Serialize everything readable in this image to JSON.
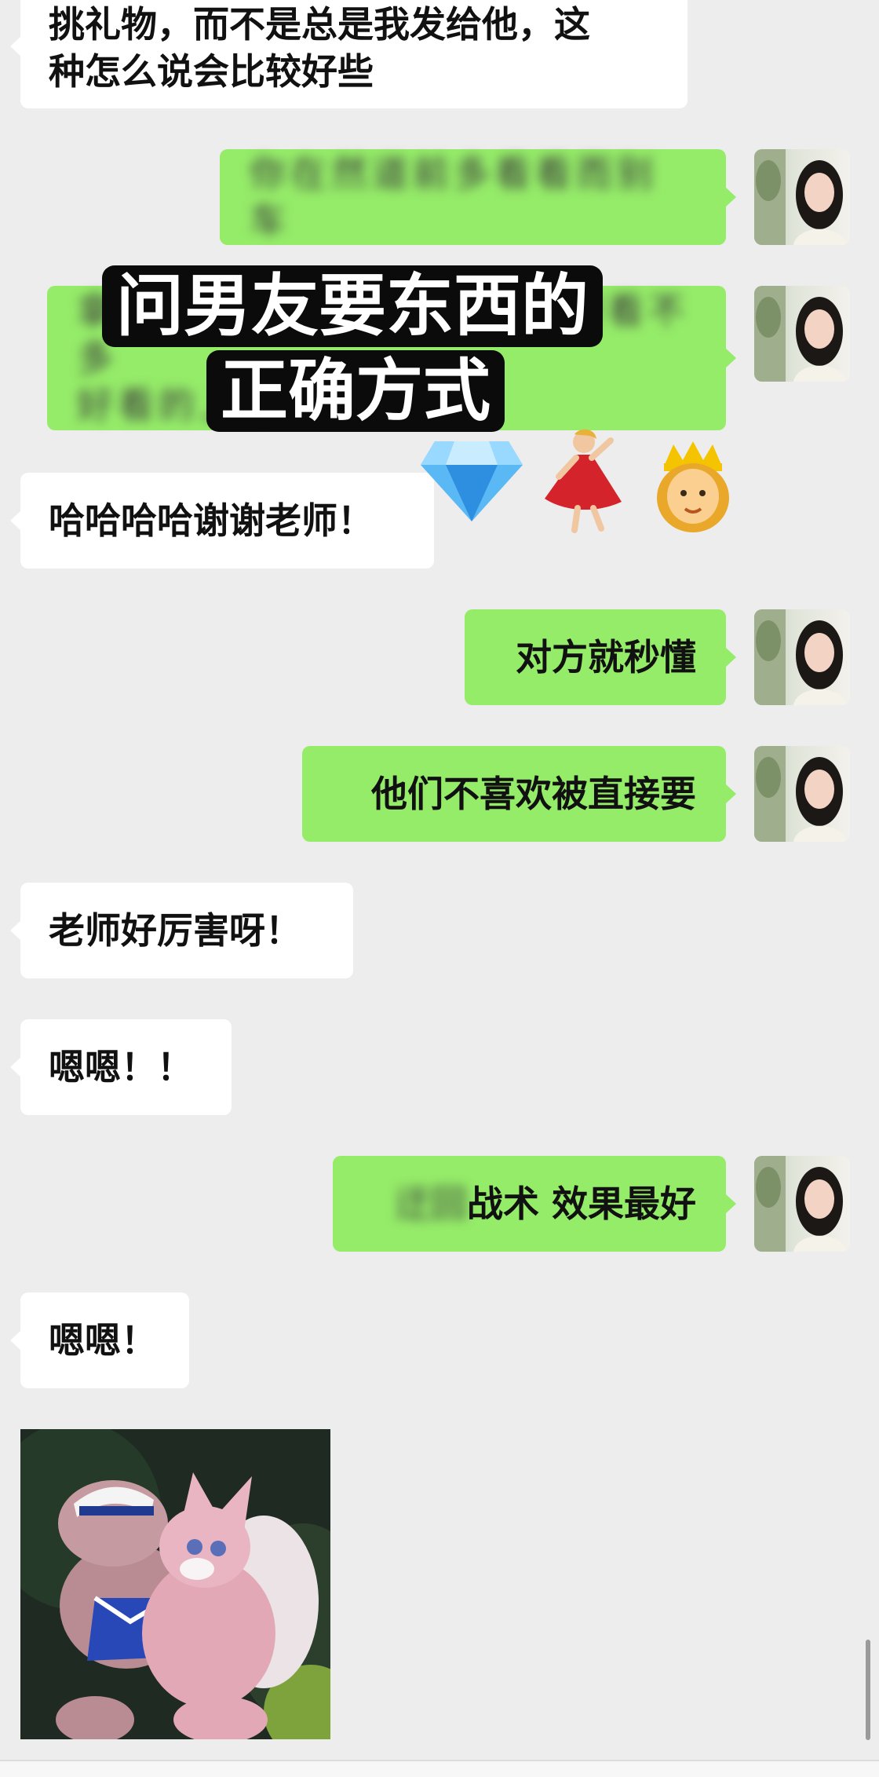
{
  "messages": {
    "m1": {
      "line1": "挑礼物，而不是总是我发给他，这",
      "line2": "种怎么说会比较好些"
    },
    "m2": {
      "blurred": "你在然道前多看看而别车"
    },
    "m3": {
      "blurred_line1": "拿在没找把他想法的表述中要看不多",
      "blurred_line2": "好看的上课"
    },
    "m4": {
      "text": "哈哈哈哈谢谢老师！"
    },
    "m5": {
      "text": "对方就秒懂"
    },
    "m6": {
      "text": "他们不喜欢被直接要"
    },
    "m7": {
      "text": "老师好厉害呀！"
    },
    "m8": {
      "text": "嗯嗯！！"
    },
    "m9": {
      "blurred_prefix": "迂回",
      "text": "战术 效果最好"
    },
    "m10": {
      "text": "嗯嗯！"
    }
  },
  "overlay": {
    "line1": "问男友要东西的",
    "line2": "正确方式"
  },
  "emojis": [
    "💎",
    "💃",
    "👸"
  ],
  "colors": {
    "background": "#ededed",
    "incoming_bubble": "#ffffff",
    "outgoing_bubble": "#95ec69",
    "overlay_bg": "#0b0b0b"
  },
  "icons": {
    "avatar": "user-avatar-photo",
    "sticker": "plush-toy-sticker"
  }
}
